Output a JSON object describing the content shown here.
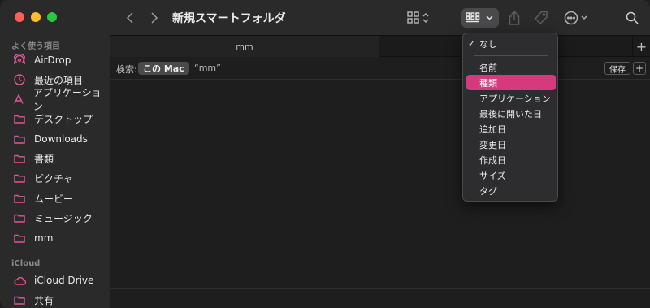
{
  "window": {
    "title": "新規スマートフォルダ"
  },
  "sidebar": {
    "section_favorites": "よく使う項目",
    "section_icloud": "iCloud",
    "items": [
      {
        "label": "AirDrop",
        "icon": "airdrop-icon"
      },
      {
        "label": "最近の項目",
        "icon": "clock-icon"
      },
      {
        "label": "アプリケーション",
        "icon": "applications-icon"
      },
      {
        "label": "デスクトップ",
        "icon": "folder-icon"
      },
      {
        "label": "Downloads",
        "icon": "folder-icon"
      },
      {
        "label": "書類",
        "icon": "folder-icon"
      },
      {
        "label": "ピクチャ",
        "icon": "folder-icon"
      },
      {
        "label": "ムービー",
        "icon": "folder-icon"
      },
      {
        "label": "ミュージック",
        "icon": "folder-icon"
      },
      {
        "label": "mm",
        "icon": "folder-icon"
      }
    ],
    "icloud_items": [
      {
        "label": "iCloud Drive",
        "icon": "cloud-icon"
      },
      {
        "label": "共有",
        "icon": "shared-folder-icon"
      }
    ]
  },
  "tabs": {
    "active": "mm",
    "new_tab": "+"
  },
  "search": {
    "label": "検索:",
    "scope_active": "この Mac",
    "scope_other": "“mm”",
    "save": "保存",
    "add": "+"
  },
  "menu": {
    "checked_item": "なし",
    "items": [
      "名前",
      "種類",
      "アプリケーション",
      "最後に開いた日",
      "追加日",
      "変更日",
      "作成日",
      "サイズ",
      "タグ"
    ],
    "selected_index": 1,
    "highlight_color": "#d63a7e"
  },
  "colors": {
    "accent": "#e0559a",
    "close": "#fe5f57",
    "minimize": "#febc2e",
    "zoom": "#28c840"
  }
}
